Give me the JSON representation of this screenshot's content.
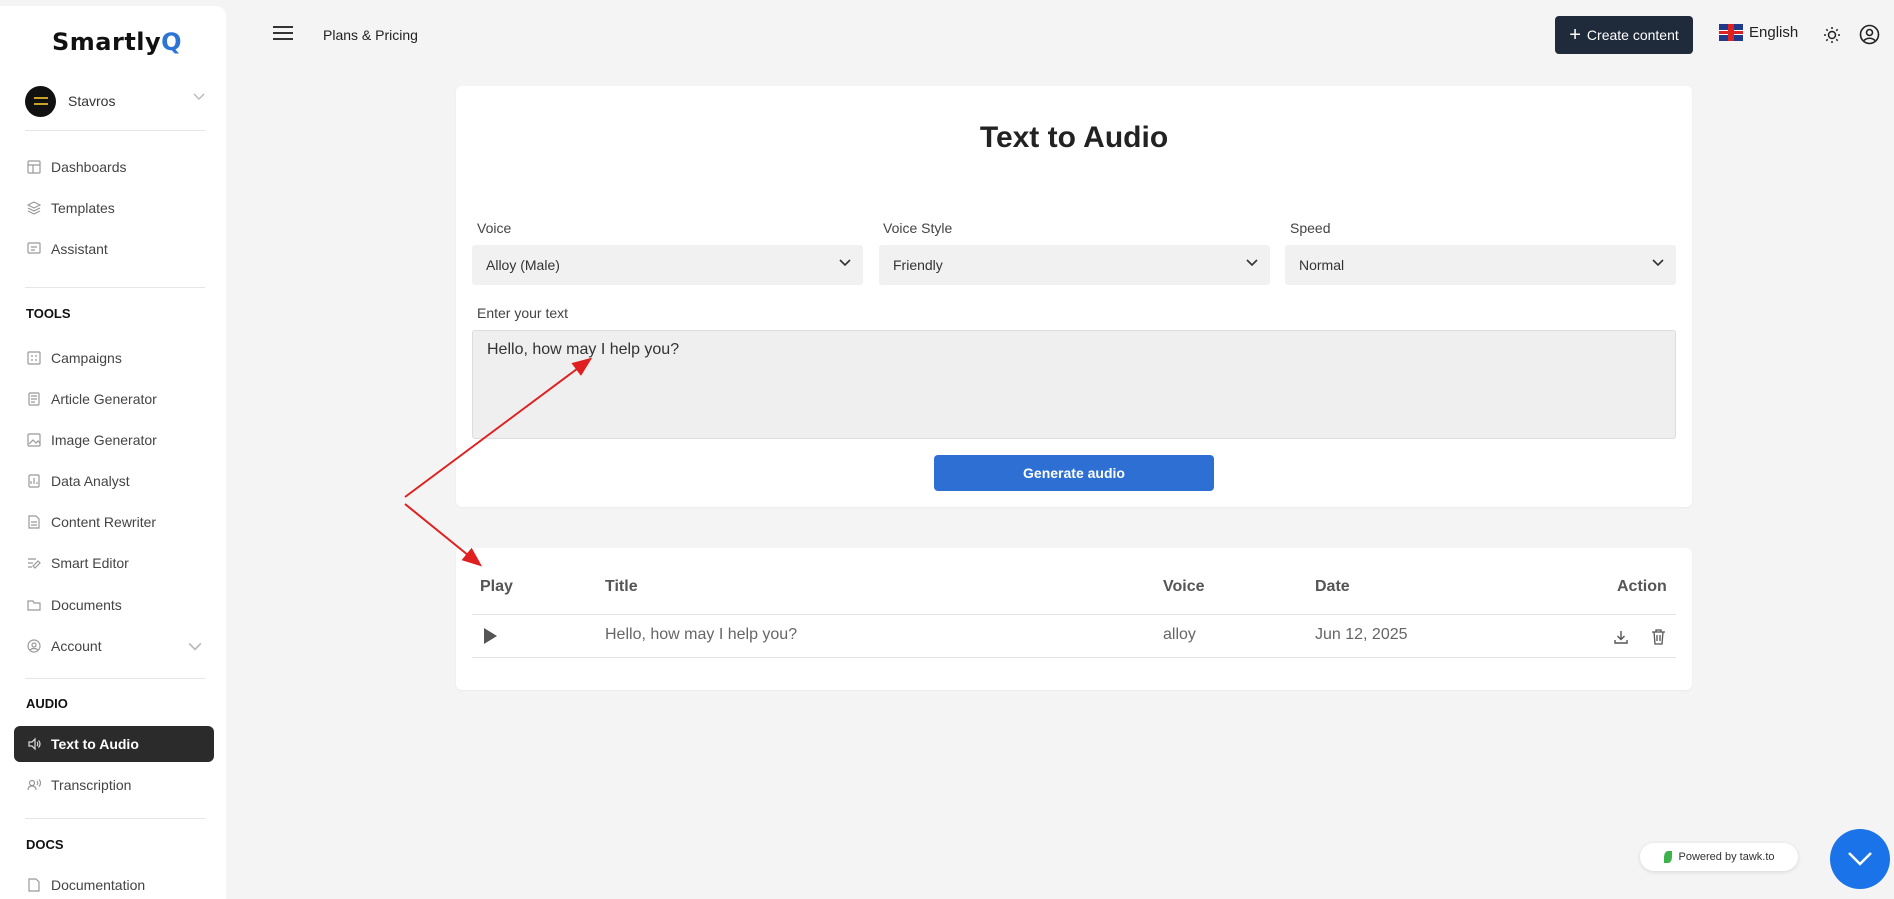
{
  "brand": {
    "name_main": "Smartly",
    "name_accent": "Q"
  },
  "user": {
    "name": "Stavros"
  },
  "nav": {
    "top": [
      {
        "label": "Dashboards",
        "icon": "dashboard-icon"
      },
      {
        "label": "Templates",
        "icon": "layers-icon"
      },
      {
        "label": "Assistant",
        "icon": "chat-icon"
      }
    ],
    "tools_label": "TOOLS",
    "tools": [
      {
        "label": "Campaigns",
        "icon": "campaign-icon"
      },
      {
        "label": "Article Generator",
        "icon": "article-icon"
      },
      {
        "label": "Image Generator",
        "icon": "image-icon"
      },
      {
        "label": "Data Analyst",
        "icon": "data-icon"
      },
      {
        "label": "Content Rewriter",
        "icon": "rewriter-icon"
      },
      {
        "label": "Smart Editor",
        "icon": "editor-icon"
      },
      {
        "label": "Documents",
        "icon": "folder-icon"
      },
      {
        "label": "Account",
        "icon": "account-icon"
      }
    ],
    "audio_label": "AUDIO",
    "audio": [
      {
        "label": "Text to Audio",
        "icon": "speaker-icon",
        "active": true
      },
      {
        "label": "Transcription",
        "icon": "transcription-icon"
      }
    ],
    "docs_label": "DOCS",
    "docs": [
      {
        "label": "Documentation",
        "icon": "doc-icon"
      }
    ]
  },
  "topbar": {
    "plans_label": "Plans & Pricing",
    "create_label": "Create content",
    "language": "English"
  },
  "form": {
    "title": "Text to Audio",
    "voice_label": "Voice",
    "voice_value": "Alloy (Male)",
    "style_label": "Voice Style",
    "style_value": "Friendly",
    "speed_label": "Speed",
    "speed_value": "Normal",
    "text_label": "Enter your text",
    "text_value": "Hello, how may I help you?",
    "generate_label": "Generate audio"
  },
  "table": {
    "headers": {
      "play": "Play",
      "title": "Title",
      "voice": "Voice",
      "date": "Date",
      "action": "Action"
    },
    "rows": [
      {
        "title": "Hello, how may I help you?",
        "voice": "alloy",
        "date": "Jun 12, 2025"
      }
    ]
  },
  "tawk": {
    "powered": "Powered by tawk.to"
  },
  "colors": {
    "accent": "#2d6fd3",
    "active_nav": "#2b2b2b",
    "create_btn": "#1f2a3a",
    "annotation": "#e02020"
  }
}
